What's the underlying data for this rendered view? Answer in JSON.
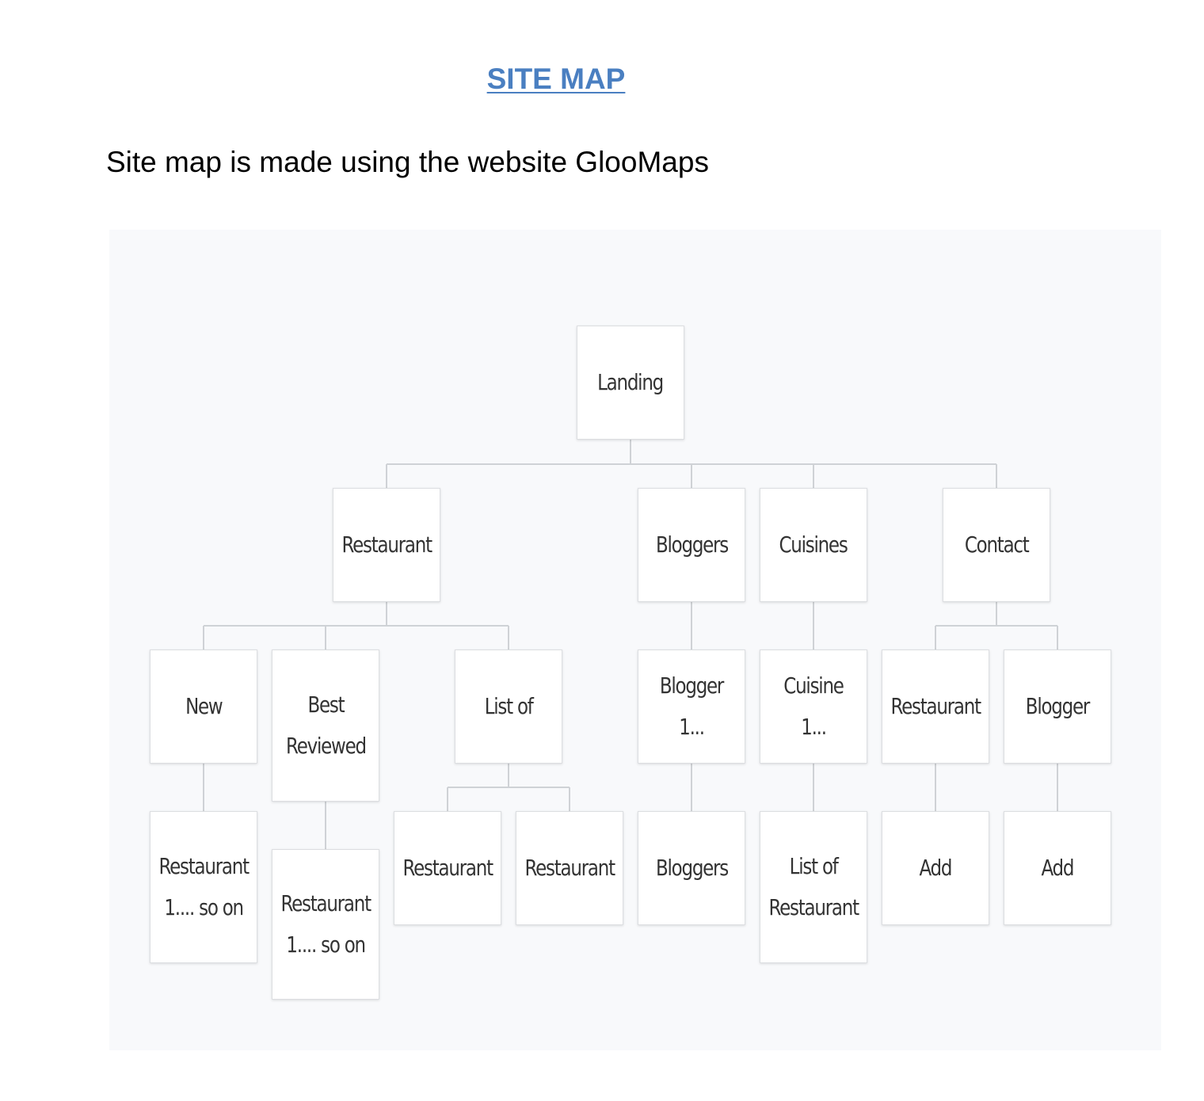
{
  "title": "SITE MAP",
  "subtitle": "Site map is made using the website GlooMaps",
  "sitemap": {
    "landing": "Landing",
    "level1": {
      "restaurant": "Restaurant",
      "bloggers": "Bloggers",
      "cuisines": "Cuisines",
      "contact": "Contact"
    },
    "level2": {
      "new": "New",
      "best_reviewed": "Best\nReviewed",
      "list_of": "List of",
      "blogger_1": "Blogger 1...",
      "cuisine_1": "Cuisine 1...",
      "contact_restaurant": "Restaurant",
      "contact_blogger": "Blogger"
    },
    "level3": {
      "new_restaurant": "Restaurant\n1.... so on",
      "best_restaurant": "Restaurant\n1.... so on",
      "list_restaurant_a": "Restaurant",
      "list_restaurant_b": "Restaurant",
      "blogger_bloggers": "Bloggers",
      "cuisine_list": "List of\nRestaurant",
      "restaurant_add": "Add",
      "blogger_add": "Add"
    }
  },
  "colors": {
    "title": "#4a7fc1",
    "canvas": "#f8f9fb",
    "node_border": "#dcdee1",
    "connector": "#cfd2d6"
  }
}
